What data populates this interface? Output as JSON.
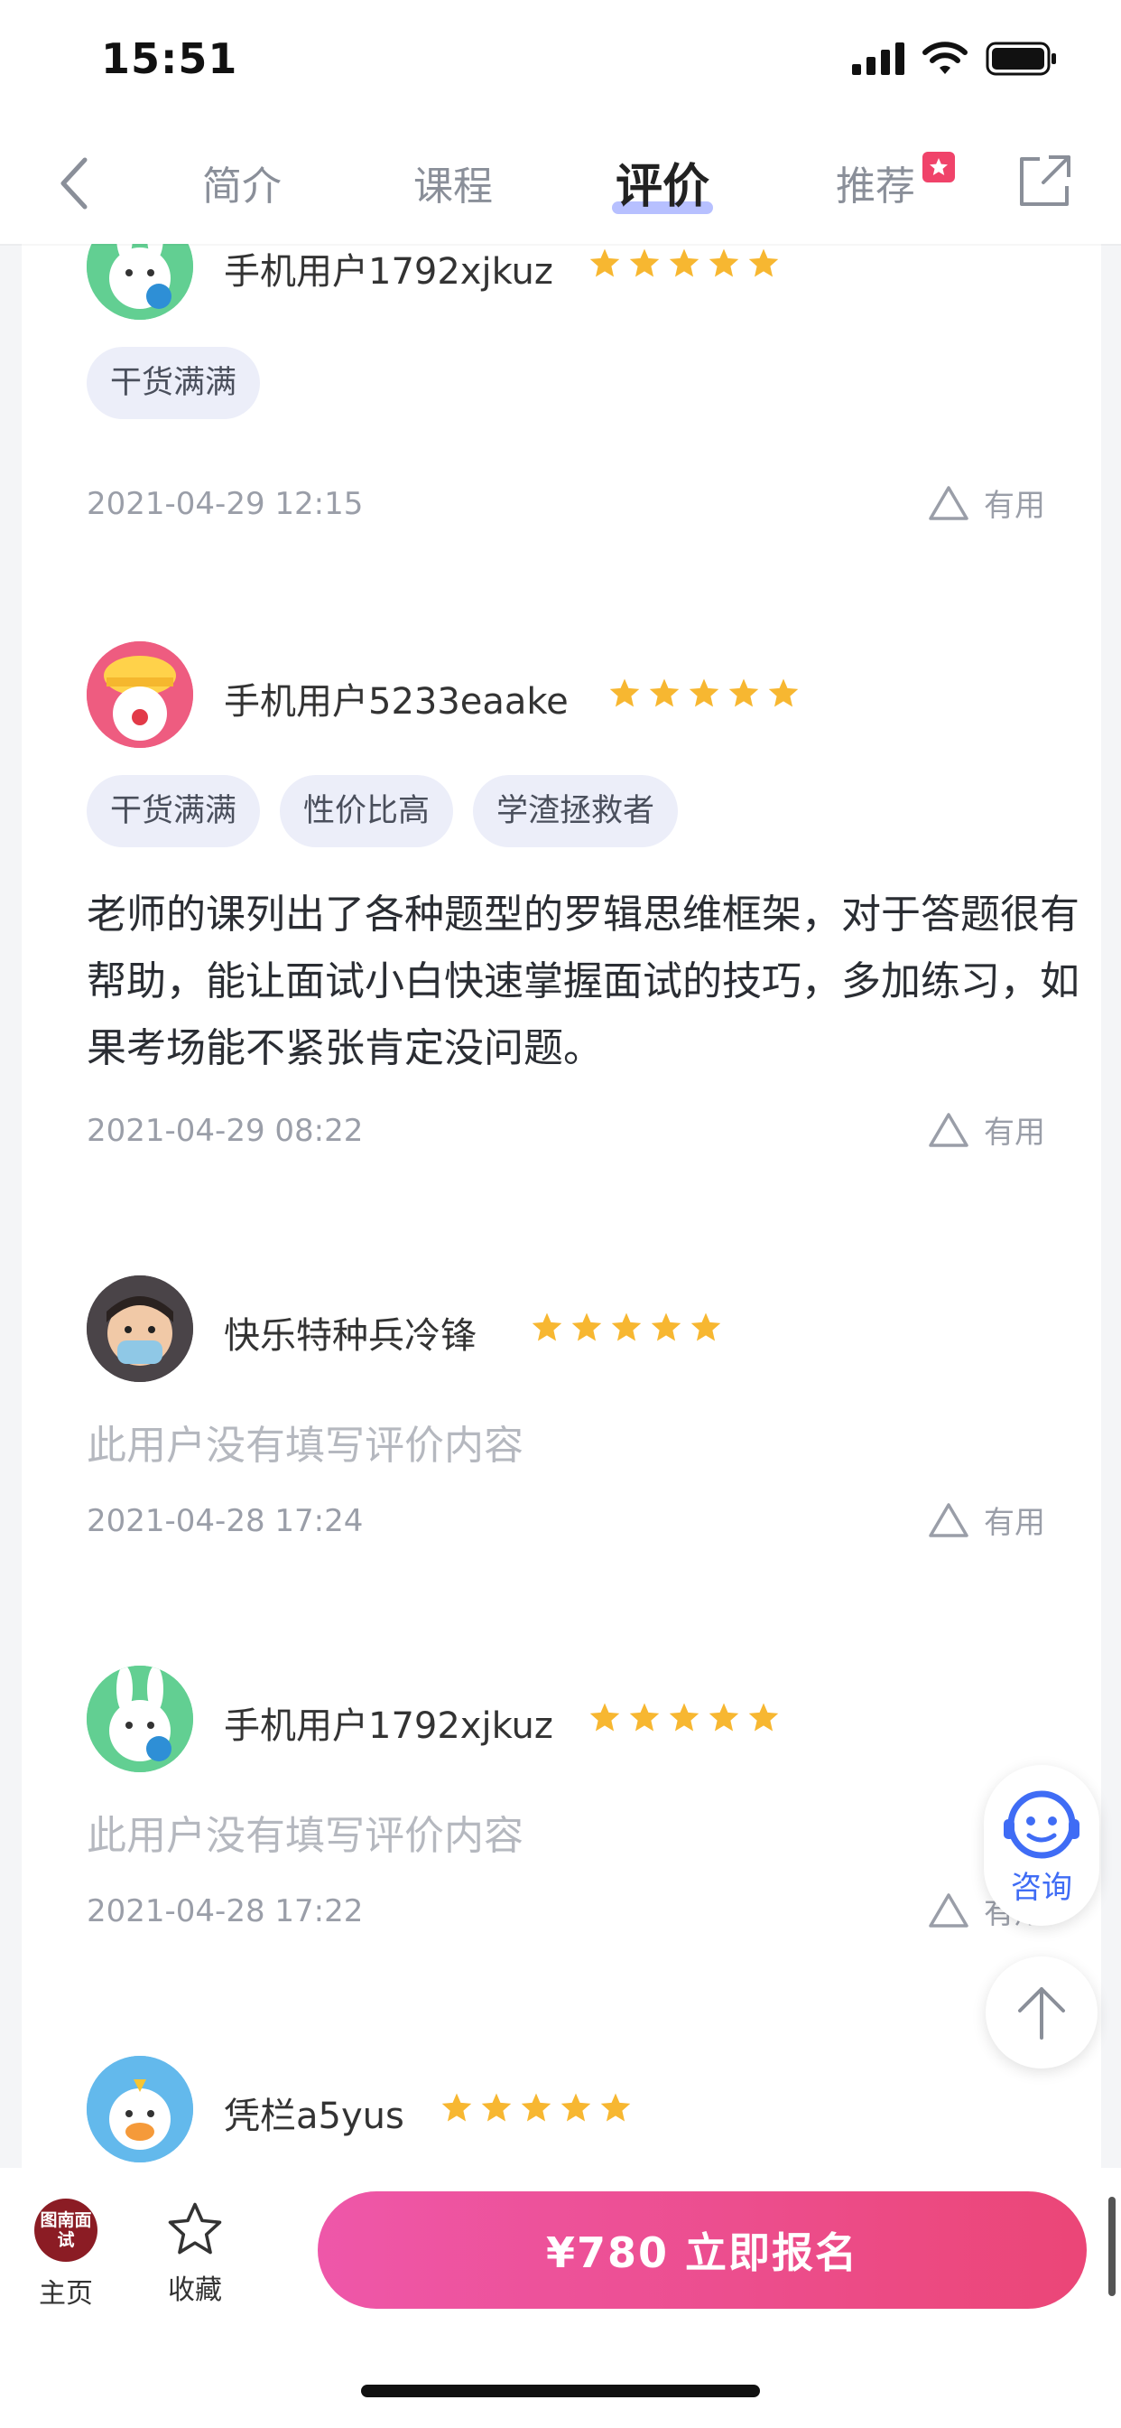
{
  "status": {
    "time": "15:51"
  },
  "nav": {
    "tabs": [
      {
        "label": "简介"
      },
      {
        "label": "课程"
      },
      {
        "label": "评价"
      },
      {
        "label": "推荐"
      }
    ],
    "active_tab": "评价"
  },
  "reviews": [
    {
      "user": "手机用户1792xjkuz",
      "rating": 5,
      "tags": [
        "干货满满"
      ],
      "text": "",
      "date": "2021-04-29 12:15",
      "useful_label": "有用"
    },
    {
      "user": "手机用户5233eaake",
      "rating": 5,
      "tags": [
        "干货满满",
        "性价比高",
        "学渣拯救者"
      ],
      "text": "老师的课列出了各种题型的罗辑思维框架，对于答题很有帮助，能让面试小白快速掌握面试的技巧，多加练习，如果考场能不紧张肯定没问题。",
      "date": "2021-04-29 08:22",
      "useful_label": "有用"
    },
    {
      "user": "快乐特种兵冷锋",
      "rating": 5,
      "tags": [],
      "empty_text": "此用户没有填写评价内容",
      "date": "2021-04-28 17:24",
      "useful_label": "有用"
    },
    {
      "user": "手机用户1792xjkuz",
      "rating": 5,
      "tags": [],
      "empty_text": "此用户没有填写评价内容",
      "date": "2021-04-28 17:22",
      "useful_label": "有用"
    },
    {
      "user": "凭栏a5yus",
      "rating": 5
    }
  ],
  "float": {
    "consult_label": "咨询"
  },
  "bottom": {
    "home_logo": "图南面试",
    "home_label": "主页",
    "fav_label": "收藏",
    "enroll_label": "¥780  立即报名"
  },
  "colors": {
    "accent": "#3f6cf5",
    "star": "#f7b731",
    "enroll_start": "#ee57a9",
    "enroll_end": "#eb4677"
  }
}
